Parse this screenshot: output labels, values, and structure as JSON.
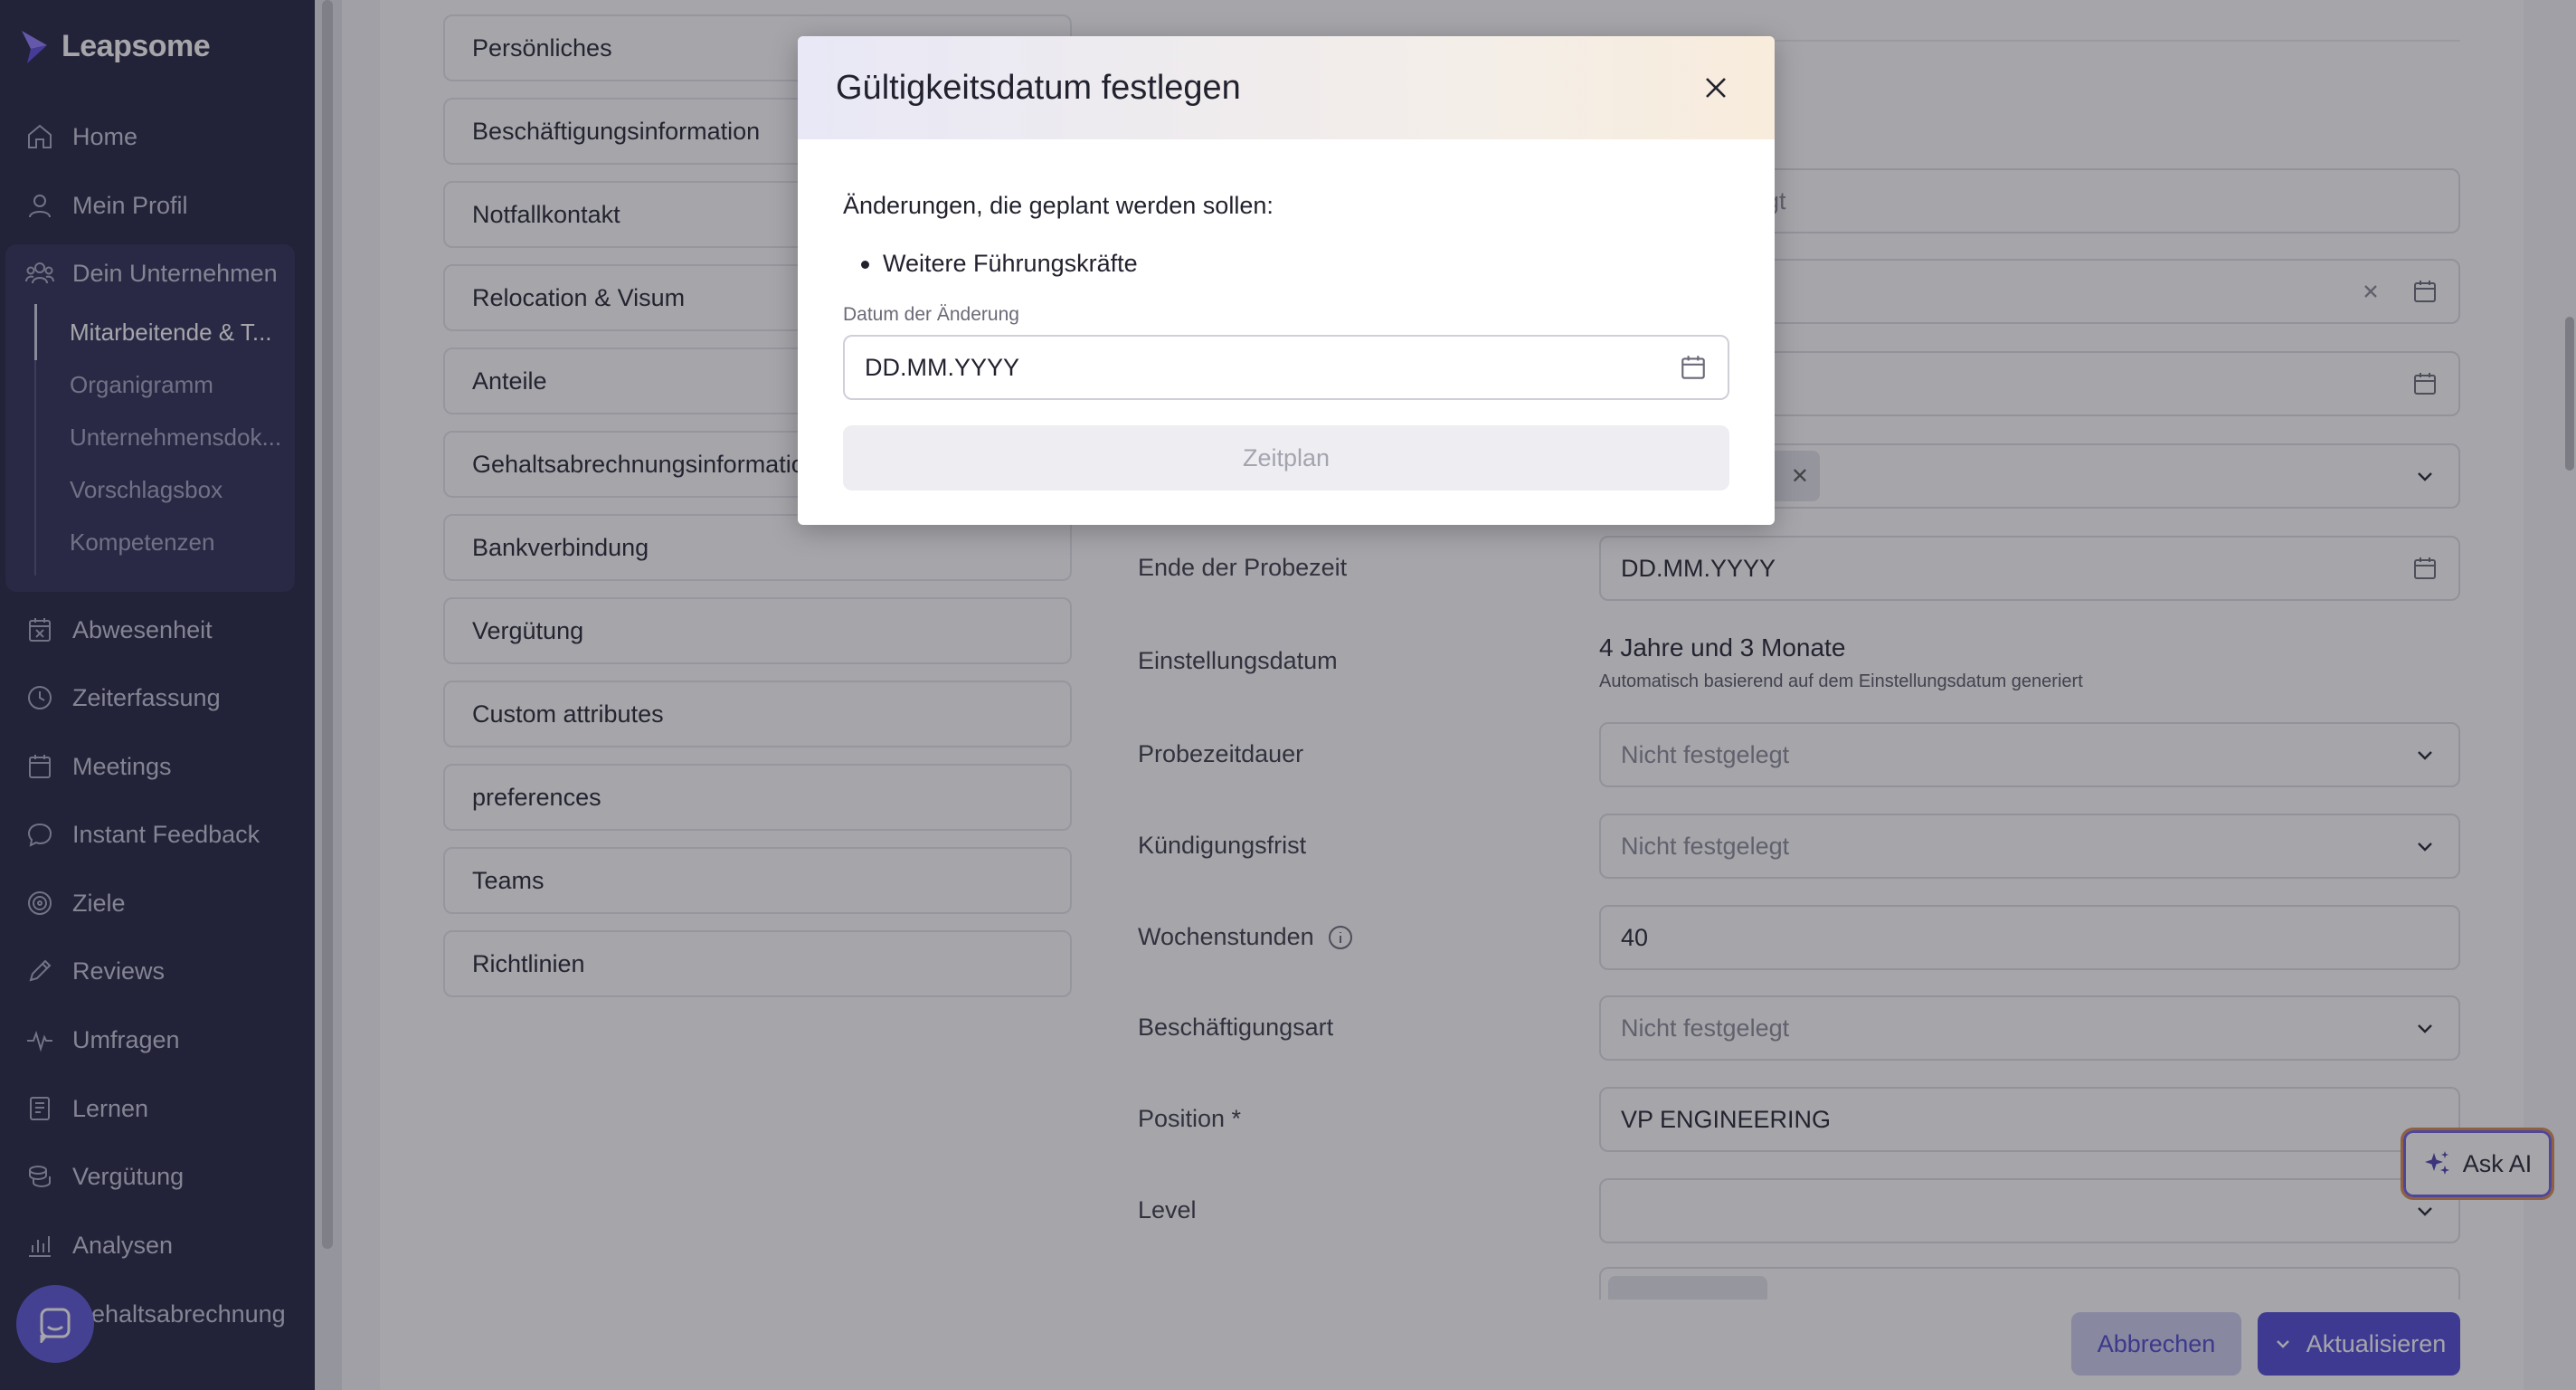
{
  "brand": {
    "name": "Leapsome"
  },
  "sidebar": {
    "items": [
      {
        "label": "Home",
        "icon": "home-icon"
      },
      {
        "label": "Mein Profil",
        "icon": "user-icon"
      },
      {
        "label": "Dein Unternehmen",
        "icon": "users-icon"
      },
      {
        "label": "Abwesenheit",
        "icon": "calendar-x-icon"
      },
      {
        "label": "Zeiterfassung",
        "icon": "clock-icon"
      },
      {
        "label": "Meetings",
        "icon": "calendar-icon"
      },
      {
        "label": "Instant Feedback",
        "icon": "chat-icon"
      },
      {
        "label": "Ziele",
        "icon": "target-icon"
      },
      {
        "label": "Reviews",
        "icon": "pencil-icon"
      },
      {
        "label": "Umfragen",
        "icon": "pulse-icon"
      },
      {
        "label": "Lernen",
        "icon": "book-icon"
      },
      {
        "label": "Vergütung",
        "icon": "coins-icon"
      },
      {
        "label": "Analysen",
        "icon": "chart-icon"
      },
      {
        "label": "Gehaltsabrechnung",
        "icon": "payroll-icon"
      }
    ],
    "sub_items": [
      {
        "label": "Mitarbeitende & T..."
      },
      {
        "label": "Organigramm"
      },
      {
        "label": "Unternehmensdok..."
      },
      {
        "label": "Vorschlagsbox"
      },
      {
        "label": "Kompetenzen"
      }
    ]
  },
  "sections": [
    "Persönliches",
    "Beschäftigungsinformation",
    "Notfallkontakt",
    "Relocation & Visum",
    "Anteile",
    "Gehaltsabrechnungsinformationen",
    "Bankverbindung",
    "Vergütung",
    "Custom attributes",
    "preferences",
    "Teams",
    "Richtlinien"
  ],
  "form": {
    "partial_placeholder": "gt",
    "ende_probezeit": {
      "label": "Ende der Probezeit",
      "placeholder": "DD.MM.YYYY"
    },
    "einstellungsdatum": {
      "label": "Einstellungsdatum",
      "value": "4 Jahre und 3 Monate",
      "hint": "Automatisch basierend auf dem Einstellungsdatum generiert"
    },
    "probezeitdauer": {
      "label": "Probezeitdauer",
      "value": "Nicht festgelegt"
    },
    "kuendigungsfrist": {
      "label": "Kündigungsfrist",
      "value": "Nicht festgelegt"
    },
    "wochenstunden": {
      "label": "Wochenstunden",
      "value": "40"
    },
    "beschaeftigungsart": {
      "label": "Beschäftigungsart",
      "value": "Nicht festgelegt"
    },
    "position": {
      "label": "Position *",
      "value": "VP ENGINEERING"
    },
    "level": {
      "label": "Level",
      "value": ""
    }
  },
  "actions": {
    "cancel": "Abbrechen",
    "update": "Aktualisieren",
    "ask_ai": "Ask AI"
  },
  "modal": {
    "title": "Gültigkeitsdatum festlegen",
    "intro": "Änderungen, die geplant werden sollen:",
    "changes": [
      "Weitere Führungskräfte"
    ],
    "date_label": "Datum der Änderung",
    "date_placeholder": "DD.MM.YYYY",
    "submit": "Zeitplan"
  },
  "colors": {
    "sidebar": "#1e1e3c",
    "accent": "#4f48d4",
    "overlay": "rgba(40,40,52,0.42)"
  }
}
